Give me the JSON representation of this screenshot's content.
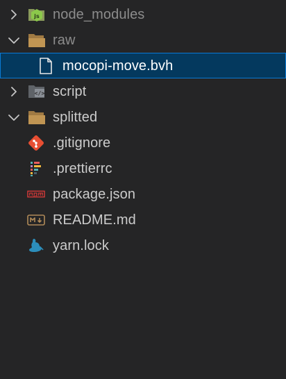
{
  "explorer": {
    "items": [
      {
        "label": "node_modules",
        "icon": "nodejs-folder-icon",
        "type": "folder",
        "state": "collapsed",
        "dimmed": true
      },
      {
        "label": "raw",
        "icon": "folder-open-icon",
        "type": "folder",
        "state": "expanded",
        "dimmed": true
      },
      {
        "label": "mocopi-move.bvh",
        "icon": "file-icon",
        "type": "file",
        "selected": true
      },
      {
        "label": "script",
        "icon": "script-folder-icon",
        "type": "folder",
        "state": "collapsed"
      },
      {
        "label": "splitted",
        "icon": "folder-open-icon",
        "type": "folder",
        "state": "expanded"
      },
      {
        "label": ".gitignore",
        "icon": "git-icon",
        "type": "file"
      },
      {
        "label": ".prettierrc",
        "icon": "prettier-icon",
        "type": "file"
      },
      {
        "label": "package.json",
        "icon": "npm-icon",
        "type": "file"
      },
      {
        "label": "README.md",
        "icon": "markdown-icon",
        "type": "file"
      },
      {
        "label": "yarn.lock",
        "icon": "yarn-icon",
        "type": "file"
      }
    ]
  },
  "colors": {
    "background": "#252526",
    "selection": "#04395e",
    "selection_border": "#0a7ad6",
    "text": "#cccccc",
    "dimmed_text": "#8c8c8c",
    "folder": "#c09553",
    "git": "#e84e32",
    "npm": "#cb3837",
    "yarn": "#2c8ebb",
    "node": "#8cc84b"
  }
}
